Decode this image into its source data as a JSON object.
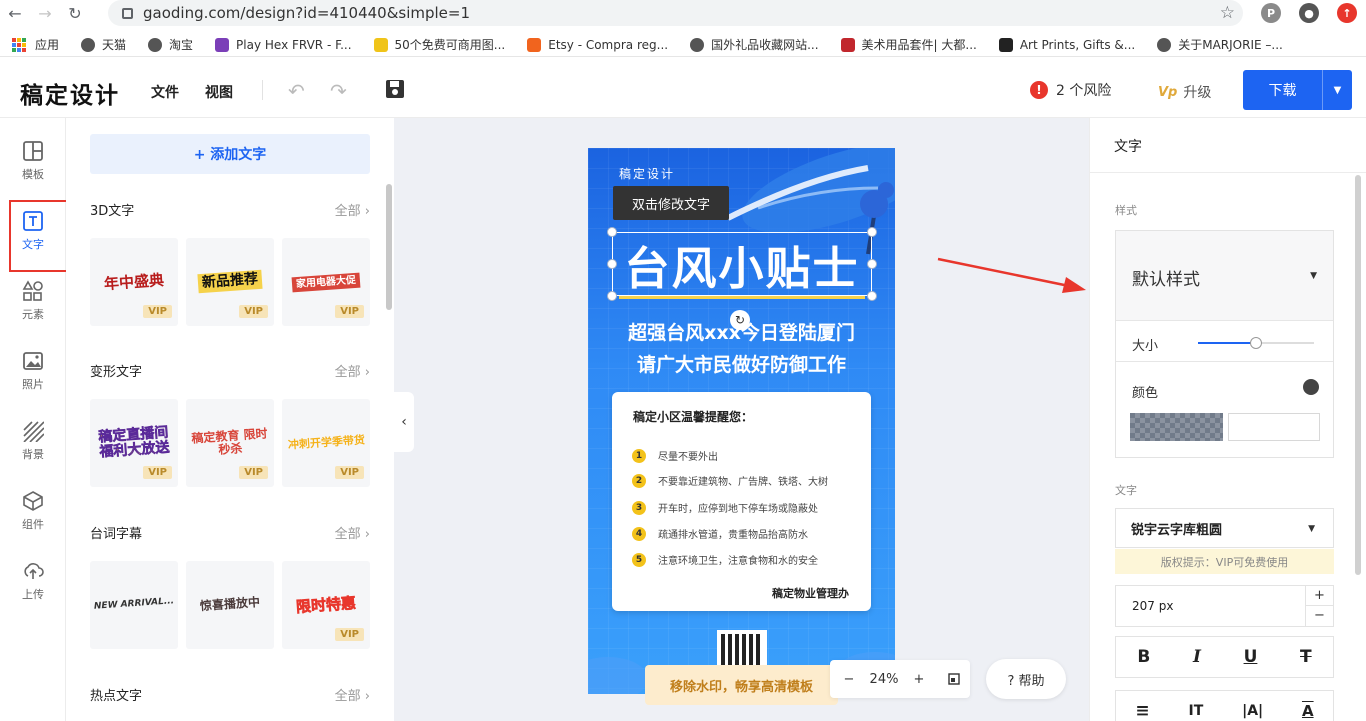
{
  "browser": {
    "url": "gaoding.com/design?id=410440&simple=1",
    "bookmarks": [
      {
        "label": "应用",
        "color": "#333"
      },
      {
        "label": "天猫",
        "color": "#555"
      },
      {
        "label": "淘宝",
        "color": "#555"
      },
      {
        "label": "Play Hex FRVR - F...",
        "color": "#7b3fb8"
      },
      {
        "label": "50个免费可商用图...",
        "color": "#f0c419"
      },
      {
        "label": "Etsy - Compra reg...",
        "color": "#f1641e"
      },
      {
        "label": "国外礼品收藏网站...",
        "color": "#555"
      },
      {
        "label": "美术用品套件| 大都...",
        "color": "#c1272d"
      },
      {
        "label": "Art Prints, Gifts &...",
        "color": "#222"
      },
      {
        "label": "关于MARJORIE –...",
        "color": "#555"
      }
    ]
  },
  "header": {
    "logo": "稿定设计",
    "menu": [
      "文件",
      "视图"
    ],
    "risk_count": "2 个风险",
    "risk_icon": "!",
    "upgrade_badge": "Vp",
    "upgrade": "升级",
    "download": "下载"
  },
  "left_nav": [
    {
      "label": "模板",
      "icon": "template-icon"
    },
    {
      "label": "文字",
      "icon": "text-icon"
    },
    {
      "label": "元素",
      "icon": "elements-icon"
    },
    {
      "label": "照片",
      "icon": "photo-icon"
    },
    {
      "label": "背景",
      "icon": "background-icon"
    },
    {
      "label": "组件",
      "icon": "component-icon"
    },
    {
      "label": "上传",
      "icon": "upload-icon"
    }
  ],
  "text_panel": {
    "add_text": "+ 添加文字",
    "all_label": "全部",
    "vip": "VIP",
    "sections": [
      {
        "title": "3D文字",
        "tiles": [
          "年中盛典",
          "新品推荐",
          "家用电器大促"
        ]
      },
      {
        "title": "变形文字",
        "tiles": [
          "稿定直播间 福利大放送",
          "稿定教育 限时秒杀",
          "冲刺开学季带货"
        ]
      },
      {
        "title": "台词字幕",
        "tiles": [
          "NEW ARRIVAL...",
          "惊喜播放中",
          "限时特惠"
        ]
      },
      {
        "title": "热点文字",
        "tiles": []
      }
    ]
  },
  "poster": {
    "brand": "稿定设计",
    "tooltip": "双击修改文字",
    "title": "台风小贴士",
    "sub1": "超强台风xxx今日登陆厦门",
    "sub2": "请广大市民做好防御工作",
    "notice_title": "稿定小区温馨提醒您：",
    "tips": [
      "尽量不要外出",
      "不要靠近建筑物、广告牌、铁塔、大树",
      "开车时，应停到地下停车场或隐蔽处",
      "疏通排水管道，贵重物品抬高防水",
      "注意环境卫生，注意食物和水的安全"
    ],
    "notice_sign": "稿定物业管理办"
  },
  "canvas_controls": {
    "watermark": "移除水印，畅享高清模板",
    "zoom": "24%",
    "minus": "−",
    "plus": "+",
    "help": "? 帮助"
  },
  "right_panel": {
    "title": "文字",
    "style_label": "样式",
    "style_name": "默认样式",
    "size_label": "大小",
    "size_level": 0.5,
    "color_label": "颜色",
    "text_label": "文字",
    "font": "锐宇云字库粗圆",
    "copyright": "版权提示：VIP可免费使用",
    "font_size": "207 px",
    "format_row1": [
      "B",
      "I",
      "U",
      "T"
    ],
    "format_row2": [
      "≡",
      "IT",
      "|A|",
      "A"
    ]
  },
  "colors": {
    "accent": "#1d64f2",
    "danger": "#e8362c",
    "vip_bg": "#f7e4b8"
  }
}
